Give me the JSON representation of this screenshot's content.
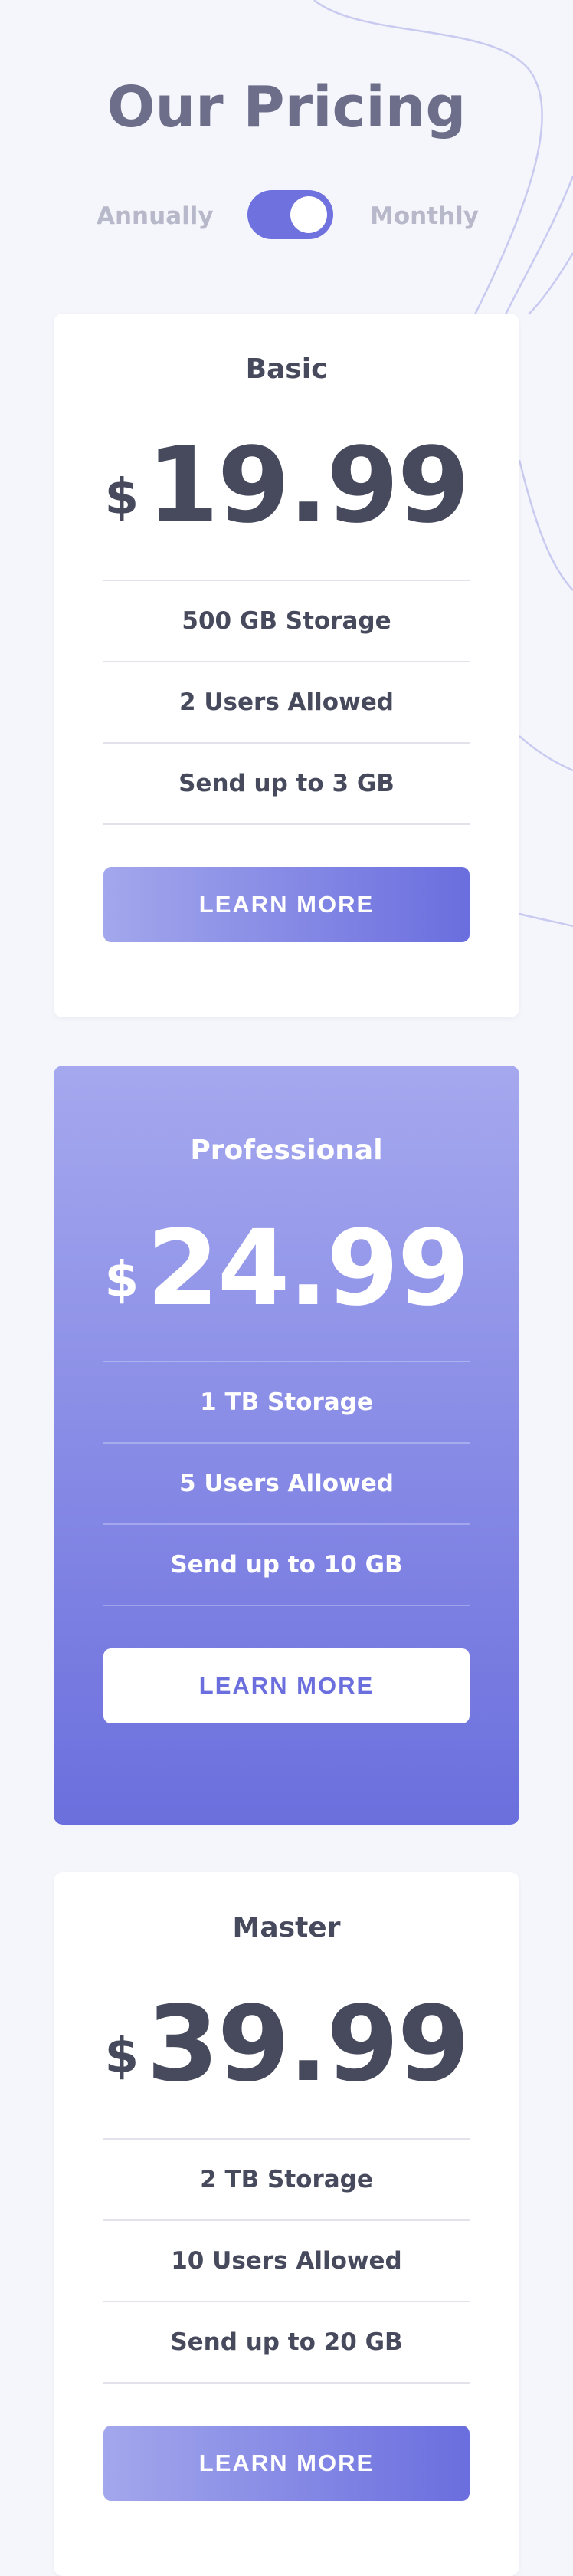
{
  "heading": "Our Pricing",
  "toggle": {
    "left_label": "Annually",
    "right_label": "Monthly",
    "state": "on"
  },
  "plans": [
    {
      "name": "Basic",
      "currency": "$",
      "price": "19.99",
      "features": [
        "500 GB Storage",
        "2 Users Allowed",
        "Send up to 3 GB"
      ],
      "button": "LEARN MORE"
    },
    {
      "name": "Professional",
      "currency": "$",
      "price": "24.99",
      "features": [
        "1 TB Storage",
        "5 Users Allowed",
        "Send up to 10 GB"
      ],
      "button": "LEARN MORE"
    },
    {
      "name": "Master",
      "currency": "$",
      "price": "39.99",
      "features": [
        "2 TB Storage",
        "10 Users Allowed",
        "Send up to 20 GB"
      ],
      "button": "LEARN MORE"
    }
  ],
  "colors": {
    "accent_start": "#a3a7ec",
    "accent_end": "#6a6ede",
    "background": "#f5f6fb",
    "heading": "#6d6e8a",
    "text": "#474a5c"
  }
}
